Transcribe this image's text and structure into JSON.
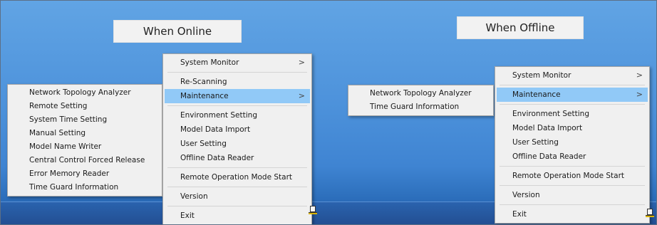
{
  "captions": {
    "online": "When Online",
    "offline": "When Offline"
  },
  "online_menu": {
    "items": [
      "System Monitor",
      "Re-Scanning",
      "Maintenance",
      "Environment Setting",
      "Model Data Import",
      "User Setting",
      "Offline Data Reader",
      "Remote Operation Mode Start",
      "Version",
      "Exit"
    ],
    "submenu_arrow": ">"
  },
  "online_submenu": {
    "items": [
      "Network Topology Analyzer",
      "Remote Setting",
      "System Time Setting",
      "Manual Setting",
      "Model Name Writer",
      "Central Control Forced Release",
      "Error Memory Reader",
      "Time Guard Information"
    ]
  },
  "offline_menu": {
    "items": [
      "System Monitor",
      "Maintenance",
      "Environment Setting",
      "Model Data Import",
      "User Setting",
      "Offline Data Reader",
      "Remote Operation Mode Start",
      "Version",
      "Exit"
    ],
    "submenu_arrow": ">"
  },
  "offline_submenu": {
    "items": [
      "Network Topology Analyzer",
      "Time Guard Information"
    ]
  },
  "tray_icon": "app-tray-icon",
  "colors": {
    "highlight": "#91c9f7",
    "menu_bg": "#f0f0f0",
    "desktop": "#4d92db",
    "taskbar": "#234f93"
  }
}
